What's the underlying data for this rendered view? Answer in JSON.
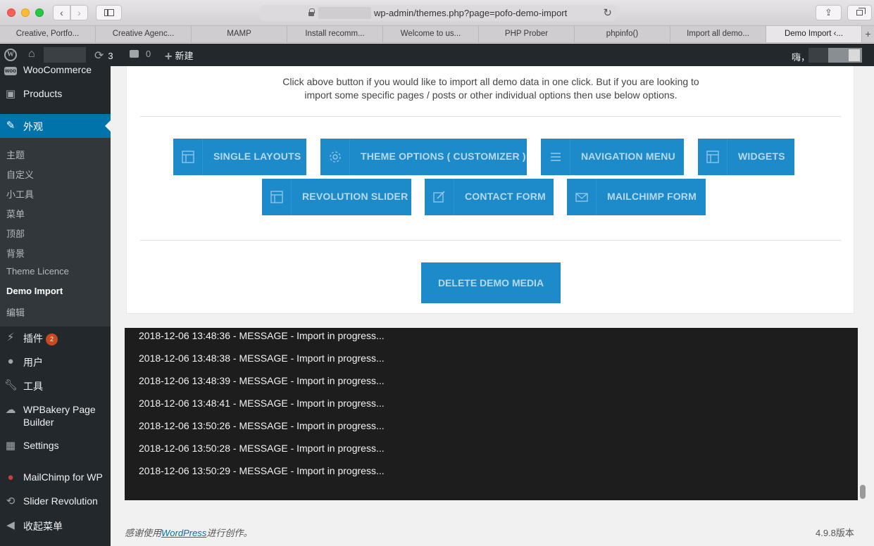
{
  "browser": {
    "url": "wp-admin/themes.php?page=pofo-demo-import",
    "tabs": [
      "Creative, Portfo...",
      "Creative Agenc...",
      "MAMP",
      "Install recomm...",
      "Welcome to us...",
      "PHP Prober",
      "phpinfo()",
      "Import all demo...",
      "Demo Import ‹..."
    ],
    "active_tab": 8,
    "new_tab": "+"
  },
  "adminbar": {
    "updates_count": "3",
    "comments_count": "0",
    "new_label": "新建",
    "howdy": "嗨，"
  },
  "sidebar": {
    "items": [
      {
        "label": "WooCommerce",
        "icon": "woo-icon"
      },
      {
        "label": "Products",
        "icon": "archive-icon"
      },
      {
        "label": "外观",
        "icon": "brush-icon"
      },
      {
        "label": "插件",
        "icon": "plugin-icon",
        "badge": "2"
      },
      {
        "label": "用户",
        "icon": "user-icon"
      },
      {
        "label": "工具",
        "icon": "wrench-icon"
      },
      {
        "label": "WPBakery Page Builder",
        "icon": "cloud-icon"
      },
      {
        "label": "Settings",
        "icon": "settings-icon"
      },
      {
        "label": "MailChimp for WP",
        "icon": "mailchimp-icon"
      },
      {
        "label": "Slider Revolution",
        "icon": "refresh-icon"
      },
      {
        "label": "收起菜单",
        "icon": "collapse-icon"
      }
    ],
    "submenu": [
      "主题",
      "自定义",
      "小工具",
      "菜单",
      "顶部",
      "背景",
      "Theme Licence",
      "Demo Import",
      "编辑"
    ]
  },
  "content": {
    "intro_line1": "Click above button if you would like to import all demo data in one click. But if you are looking to",
    "intro_line2": "import some specific pages / posts or other individual options then use below options.",
    "buttons": [
      {
        "label": "SINGLE LAYOUTS",
        "icon": "layout-icon"
      },
      {
        "label": "THEME OPTIONS ( CUSTOMIZER )",
        "icon": "gear-icon"
      },
      {
        "label": "NAVIGATION MENU",
        "icon": "menu-icon"
      },
      {
        "label": "WIDGETS",
        "icon": "layout-icon"
      },
      {
        "label": "REVOLUTION SLIDER",
        "icon": "layout-icon"
      },
      {
        "label": "CONTACT FORM",
        "icon": "edit-icon"
      },
      {
        "label": "MAILCHIMP FORM",
        "icon": "mail-icon"
      }
    ],
    "delete_label": "DELETE DEMO MEDIA"
  },
  "log": [
    "2018-12-06 13:48:36 - MESSAGE - Import in progress...",
    "2018-12-06 13:48:38 - MESSAGE - Import in progress...",
    "2018-12-06 13:48:39 - MESSAGE - Import in progress...",
    "2018-12-06 13:48:41 - MESSAGE - Import in progress...",
    "2018-12-06 13:50:26 - MESSAGE - Import in progress...",
    "2018-12-06 13:50:28 - MESSAGE - Import in progress...",
    "2018-12-06 13:50:29 - MESSAGE - Import in progress..."
  ],
  "footer": {
    "thanks_prefix": "感谢使用",
    "thanks_link": "WordPress",
    "thanks_suffix": "进行创作。",
    "version": "4.9.8版本"
  },
  "colors": {
    "accent": "#0073aa",
    "button": "#1d8bc9",
    "admin_dark": "#23282d",
    "badge": "#ca4a1f"
  }
}
